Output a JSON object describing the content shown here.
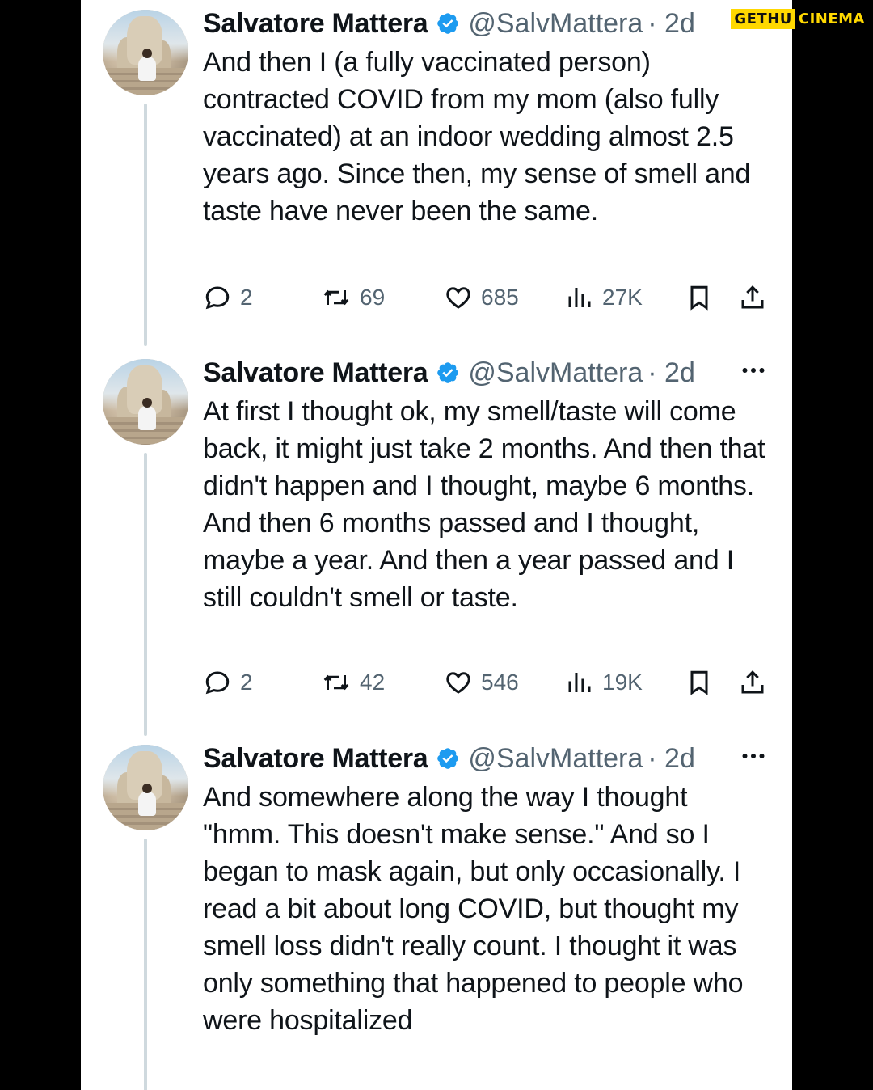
{
  "watermark": {
    "part1": "GETHU",
    "part2": "CINEMA"
  },
  "tweets": [
    {
      "author": "Salvatore Mattera",
      "handle": "@SalvMattera",
      "time": "· 2d",
      "text": "And then I (a fully vaccinated person) contracted COVID from my mom (also fully vaccinated) at an indoor wedding almost 2.5 years ago. Since then, my sense of smell and taste have never been the same.",
      "replies": "2",
      "reposts": "69",
      "likes": "685",
      "views": "27K"
    },
    {
      "author": "Salvatore Mattera",
      "handle": "@SalvMattera",
      "time": "· 2d",
      "text": "At first I thought ok, my smell/taste will come back, it might just take 2 months. And then that didn't happen and I thought, maybe 6 months. And then 6 months passed and I thought, maybe a year. And then a year passed and I still couldn't smell or taste.",
      "replies": "2",
      "reposts": "42",
      "likes": "546",
      "views": "19K"
    },
    {
      "author": "Salvatore Mattera",
      "handle": "@SalvMattera",
      "time": "· 2d",
      "text": "And somewhere along the way I thought \"hmm. This doesn't make sense.\" And so I began to mask again, but only occasionally. I read a bit about long COVID, but thought my smell loss didn't really count. I thought it was only something that happened to people who were hospitalized"
    }
  ],
  "colors": {
    "text": "#0f1419",
    "secondary": "#536471",
    "verified": "#1d9bf0",
    "thread": "#cfd9de"
  },
  "icons": [
    "verified-badge-icon",
    "more-icon",
    "reply-icon",
    "repost-icon",
    "like-icon",
    "views-icon",
    "bookmark-icon",
    "share-icon"
  ]
}
